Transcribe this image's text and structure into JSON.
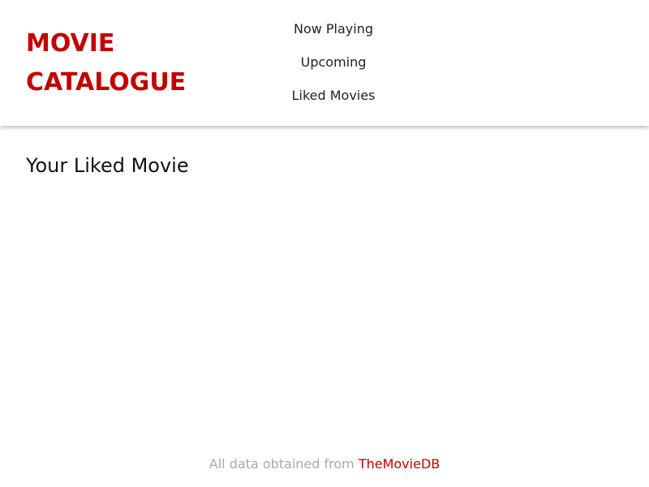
{
  "header": {
    "title_line1": "MOVIE",
    "title_line2": "CATALOGUE",
    "nav": [
      {
        "label": "Now Playing"
      },
      {
        "label": "Upcoming"
      },
      {
        "label": "Liked Movies"
      }
    ]
  },
  "main": {
    "heading": "Your Liked Movie",
    "movies": []
  },
  "footer": {
    "text": "All data obtained from",
    "link_label": "TheMovieDB"
  },
  "colors": {
    "brand": "#c40000",
    "footer_text": "#aaaaaa",
    "text": "#222222",
    "background": "#ffffff"
  }
}
